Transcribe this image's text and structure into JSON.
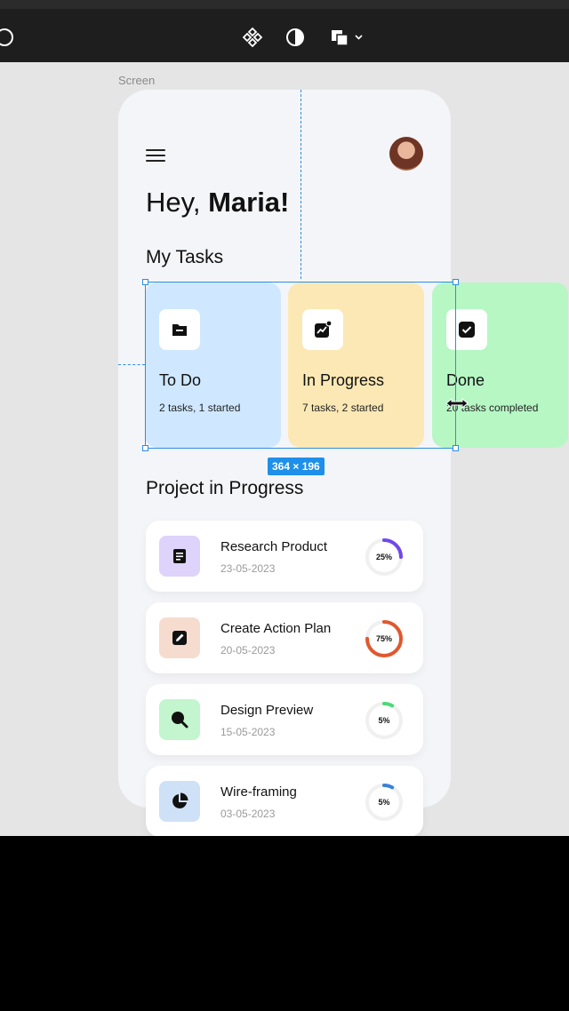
{
  "editor": {
    "frame_label": "Screen",
    "selection_size": "364 × 196"
  },
  "app": {
    "greeting_prefix": "Hey, ",
    "greeting_name": "Maria!",
    "my_tasks_title": "My Tasks",
    "task_cards": [
      {
        "title": "To Do",
        "subtitle": "2 tasks, 1 started",
        "color": "#cfe8ff",
        "icon": "folder-icon"
      },
      {
        "title": "In Progress",
        "subtitle": "7 tasks, 2 started",
        "color": "#fbe8b4",
        "icon": "trending-chart-icon"
      },
      {
        "title": "Done",
        "subtitle": "20 tasks completed",
        "color": "#b6f7c4",
        "icon": "check-square-icon"
      }
    ],
    "project_title": "Project in Progress",
    "projects": [
      {
        "name": "Research Product",
        "date": "23-05-2023",
        "progress_label": "25%",
        "progress": 0.25,
        "color": "#7048e8",
        "icon_bg": "#ddd3fb",
        "icon": "document-icon"
      },
      {
        "name": "Create Action Plan",
        "date": "20-05-2023",
        "progress_label": "75%",
        "progress": 0.75,
        "color": "#e0582f",
        "icon_bg": "#f6dccf",
        "icon": "edit-icon"
      },
      {
        "name": "Design Preview",
        "date": "15-05-2023",
        "progress_label": "5%",
        "progress": 0.05,
        "color": "#4cd97a",
        "icon_bg": "#c3f5cf",
        "icon": "search-icon"
      },
      {
        "name": "Wire-framing",
        "date": "03-05-2023",
        "progress_label": "5%",
        "progress": 0.05,
        "color": "#3b82d6",
        "icon_bg": "#cfe1f7",
        "icon": "pie-chart-icon"
      }
    ]
  }
}
